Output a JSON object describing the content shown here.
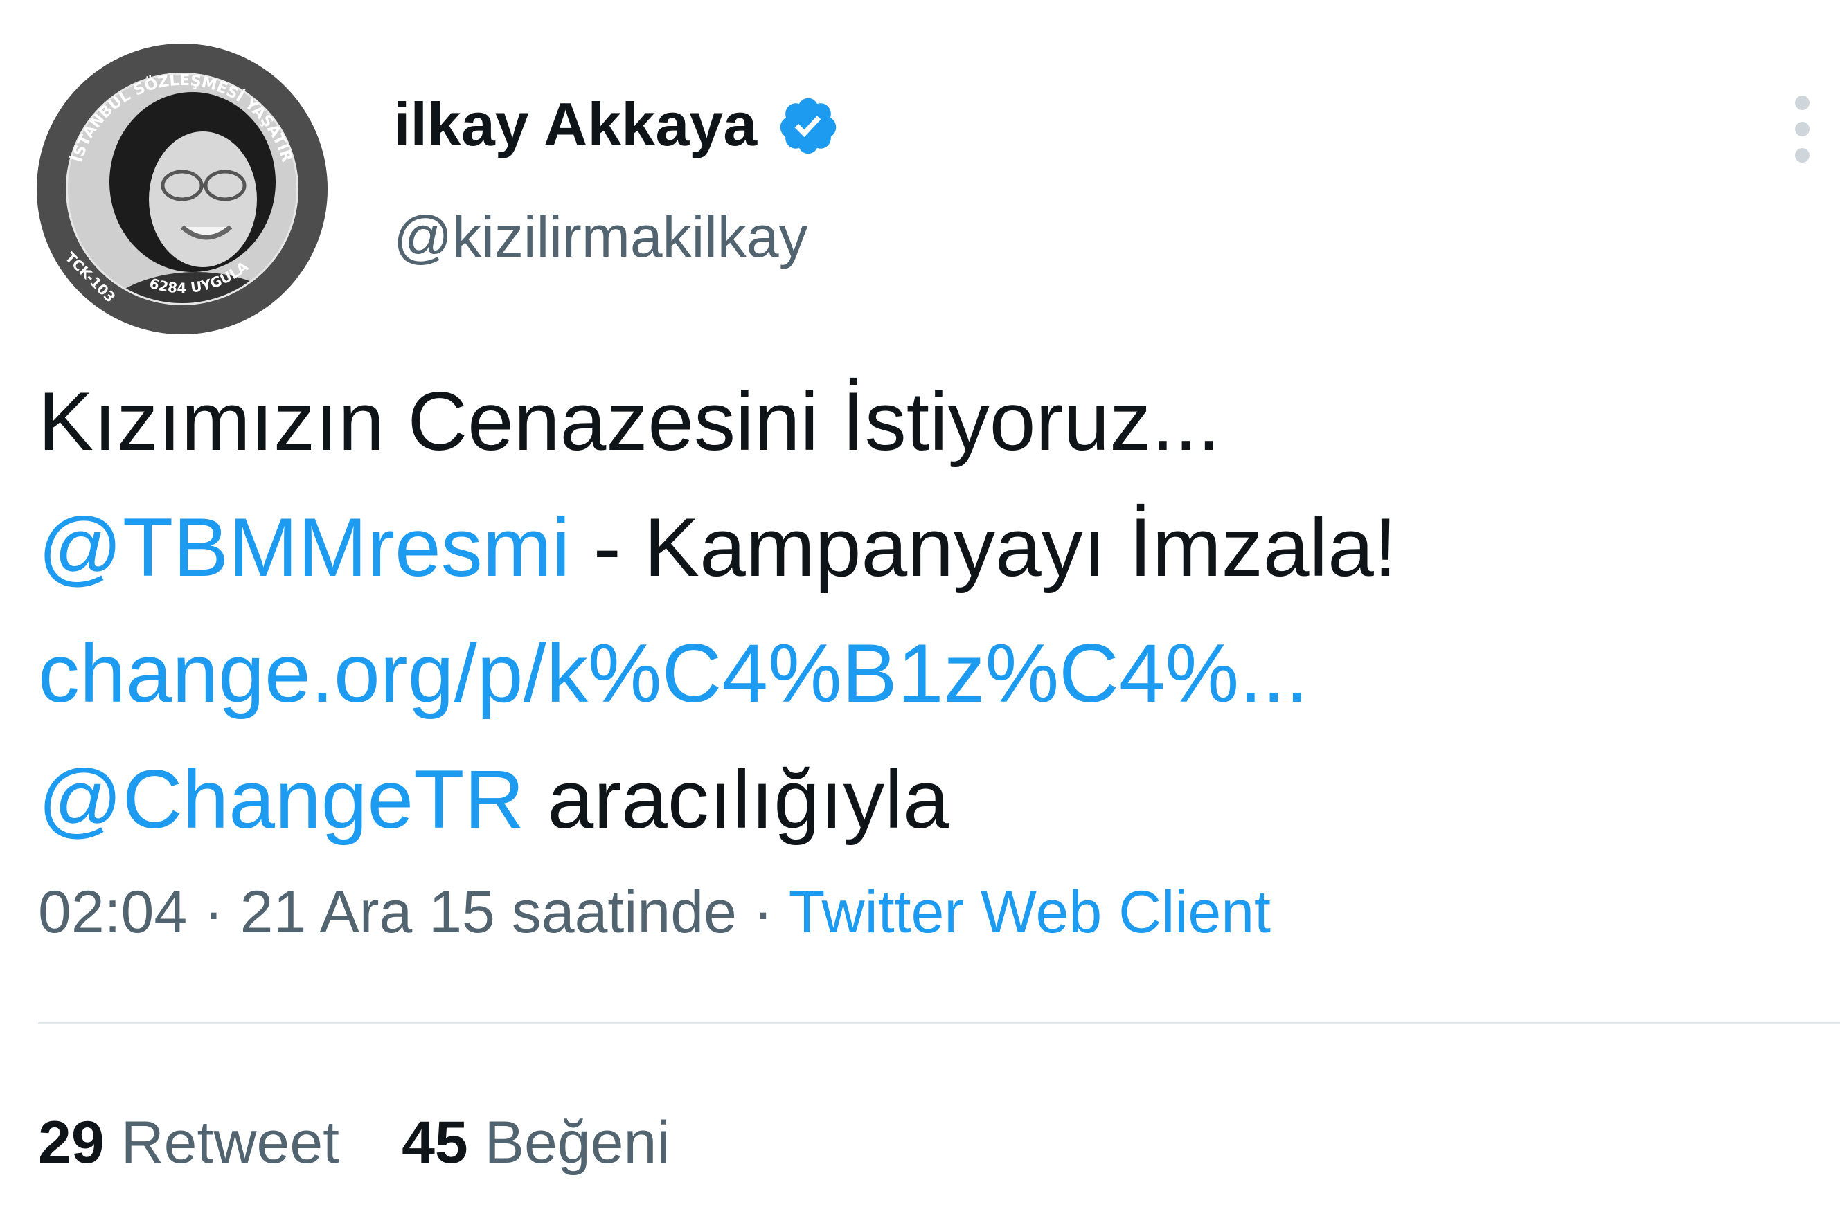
{
  "author": {
    "display_name": "ilkay Akkaya",
    "handle": "@kizilirmakilkay",
    "verified": true,
    "avatar": {
      "ring_text_top": "İSTANBUL SÖZLEŞMESİ YAŞATIR",
      "ring_text_left": "TCK-103",
      "ring_text_bottom": "6284 UYGULA"
    }
  },
  "tweet": {
    "line1": "Kızımızın Cenazesini İstiyoruz...",
    "mention1": "@TBMMresmi",
    "line2_rest": " - Kampanyayı İmzala!",
    "url": "change.org/p/k%C4%B1z%C4%...",
    "mention2": "@ChangeTR",
    "line4_rest": " aracılığıyla"
  },
  "meta": {
    "time": "02:04",
    "sep1": " · ",
    "date": "21 Ara 15 saatinde",
    "sep2": " · ",
    "source": "Twitter Web Client"
  },
  "stats": {
    "retweet_count": "29",
    "retweet_label": "Retweet",
    "like_count": "45",
    "like_label": "Beğeni"
  },
  "colors": {
    "link": "#1d9bf0",
    "text": "#0f1419",
    "secondary": "#536471",
    "verified": "#1d9bf0"
  }
}
